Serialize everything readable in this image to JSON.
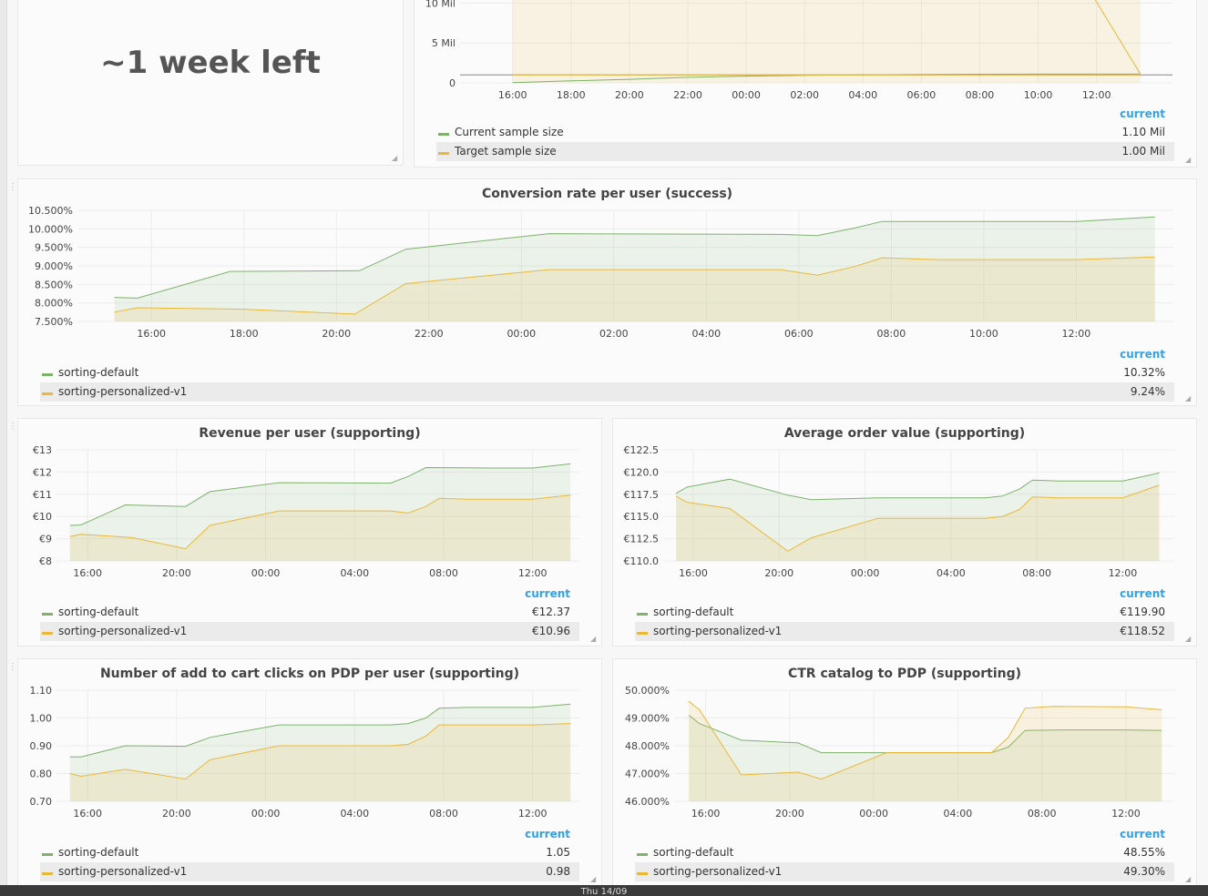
{
  "colors": {
    "green": "#7eb26d",
    "yellow": "#eab839",
    "accent": "#33a2e5"
  },
  "legend_header": "current",
  "singlestat": {
    "value": "~1 week left"
  },
  "bottom_bar": {
    "text": "Thu 14/09"
  },
  "panels": [
    {
      "id": "sample",
      "title": "",
      "series": [
        {
          "name": "Current sample size",
          "current": "1.10 Mil"
        },
        {
          "name": "Target sample size",
          "current": "1.00 Mil"
        }
      ]
    },
    {
      "id": "conversion",
      "title": "Conversion rate per user (success)",
      "series": [
        {
          "name": "sorting-default",
          "current": "10.32%"
        },
        {
          "name": "sorting-personalized-v1",
          "current": "9.24%"
        }
      ]
    },
    {
      "id": "revenue",
      "title": "Revenue per user (supporting)",
      "series": [
        {
          "name": "sorting-default",
          "current": "€12.37"
        },
        {
          "name": "sorting-personalized-v1",
          "current": "€10.96"
        }
      ]
    },
    {
      "id": "aov",
      "title": "Average order value (supporting)",
      "series": [
        {
          "name": "sorting-default",
          "current": "€119.90"
        },
        {
          "name": "sorting-personalized-v1",
          "current": "€118.52"
        }
      ]
    },
    {
      "id": "atc",
      "title": "Number of add to cart clicks on PDP per user (supporting)",
      "series": [
        {
          "name": "sorting-default",
          "current": "1.05"
        },
        {
          "name": "sorting-personalized-v1",
          "current": "0.98"
        }
      ]
    },
    {
      "id": "ctr",
      "title": "CTR catalog to PDP (supporting)",
      "series": [
        {
          "name": "sorting-default",
          "current": "48.55%"
        },
        {
          "name": "sorting-personalized-v1",
          "current": "49.30%"
        }
      ]
    }
  ],
  "chart_data": [
    {
      "id": "sample",
      "type": "area",
      "x_ticks": [
        "16:00",
        "18:00",
        "20:00",
        "22:00",
        "00:00",
        "02:00",
        "04:00",
        "06:00",
        "08:00",
        "10:00",
        "12:00"
      ],
      "y_ticks": [
        "0",
        "5 Mil",
        "10 Mil"
      ],
      "ylim": [
        0,
        10.5
      ],
      "series": [
        {
          "name": "Current sample size",
          "values": [
            [
              0,
              0.02
            ],
            [
              2,
              0.25
            ],
            [
              4,
              0.45
            ],
            [
              6,
              0.7
            ],
            [
              8,
              0.85
            ],
            [
              10,
              0.95
            ],
            [
              12,
              1.0
            ],
            [
              14,
              1.05
            ],
            [
              16,
              1.08
            ],
            [
              18,
              1.09
            ],
            [
              21.5,
              1.1
            ]
          ]
        },
        {
          "name": "Target sample size",
          "values": [
            [
              0,
              1.0
            ],
            [
              21.5,
              1.0
            ]
          ]
        }
      ]
    },
    {
      "id": "conversion",
      "type": "area",
      "x_ticks": [
        "16:00",
        "18:00",
        "20:00",
        "22:00",
        "00:00",
        "02:00",
        "04:00",
        "06:00",
        "08:00",
        "10:00",
        "12:00"
      ],
      "y_ticks": [
        "7.500%",
        "8.000%",
        "8.500%",
        "9.000%",
        "9.500%",
        "10.000%",
        "10.500%"
      ],
      "ylim": [
        7.5,
        10.5
      ],
      "series": [
        {
          "name": "sorting-default",
          "values": [
            [
              -0.8,
              8.15
            ],
            [
              -0.3,
              8.13
            ],
            [
              1.7,
              8.85
            ],
            [
              4.5,
              8.87
            ],
            [
              5.5,
              9.45
            ],
            [
              8.6,
              9.87
            ],
            [
              13.6,
              9.85
            ],
            [
              14.4,
              9.82
            ],
            [
              15.2,
              10.02
            ],
            [
              15.8,
              10.2
            ],
            [
              18,
              10.2
            ],
            [
              20,
              10.2
            ],
            [
              21.7,
              10.32
            ]
          ]
        },
        {
          "name": "sorting-personalized-v1",
          "values": [
            [
              -0.8,
              7.75
            ],
            [
              -0.3,
              7.87
            ],
            [
              2,
              7.83
            ],
            [
              4.4,
              7.7
            ],
            [
              5.5,
              8.52
            ],
            [
              8.6,
              8.9
            ],
            [
              13.6,
              8.9
            ],
            [
              14.4,
              8.75
            ],
            [
              15.2,
              8.98
            ],
            [
              15.8,
              9.22
            ],
            [
              17,
              9.17
            ],
            [
              20,
              9.17
            ],
            [
              21.7,
              9.24
            ]
          ]
        }
      ]
    },
    {
      "id": "revenue",
      "type": "area",
      "x_ticks": [
        "16:00",
        "20:00",
        "00:00",
        "04:00",
        "08:00",
        "12:00"
      ],
      "y_ticks": [
        "€8",
        "€9",
        "€10",
        "€11",
        "€12",
        "€13"
      ],
      "ylim": [
        8,
        13
      ],
      "series": [
        {
          "name": "sorting-default",
          "values": [
            [
              -0.8,
              9.6
            ],
            [
              -0.3,
              9.62
            ],
            [
              1.7,
              10.52
            ],
            [
              4.4,
              10.45
            ],
            [
              5.5,
              11.12
            ],
            [
              8.6,
              11.52
            ],
            [
              13.6,
              11.5
            ],
            [
              14.4,
              11.8
            ],
            [
              15.2,
              12.2
            ],
            [
              18,
              12.18
            ],
            [
              20,
              12.18
            ],
            [
              21.7,
              12.37
            ]
          ]
        },
        {
          "name": "sorting-personalized-v1",
          "values": [
            [
              -0.8,
              9.1
            ],
            [
              -0.3,
              9.2
            ],
            [
              2,
              9.05
            ],
            [
              4.4,
              8.55
            ],
            [
              5.5,
              9.6
            ],
            [
              8.6,
              10.25
            ],
            [
              13.6,
              10.25
            ],
            [
              14.4,
              10.15
            ],
            [
              15.2,
              10.45
            ],
            [
              15.8,
              10.82
            ],
            [
              17,
              10.78
            ],
            [
              20,
              10.78
            ],
            [
              21.7,
              10.96
            ]
          ]
        }
      ]
    },
    {
      "id": "aov",
      "type": "area",
      "x_ticks": [
        "16:00",
        "20:00",
        "00:00",
        "04:00",
        "08:00",
        "12:00"
      ],
      "y_ticks": [
        "€110.0",
        "€112.5",
        "€115.0",
        "€117.5",
        "€120.0",
        "€122.5"
      ],
      "ylim": [
        110,
        122.5
      ],
      "series": [
        {
          "name": "sorting-default",
          "values": [
            [
              -0.8,
              117.6
            ],
            [
              -0.3,
              118.3
            ],
            [
              1.7,
              119.2
            ],
            [
              4.4,
              117.4
            ],
            [
              5.5,
              116.9
            ],
            [
              8.6,
              117.1
            ],
            [
              13.6,
              117.1
            ],
            [
              14.4,
              117.3
            ],
            [
              15.2,
              118.1
            ],
            [
              15.8,
              119.1
            ],
            [
              17,
              119.0
            ],
            [
              20,
              119.0
            ],
            [
              21.7,
              119.9
            ]
          ]
        },
        {
          "name": "sorting-personalized-v1",
          "values": [
            [
              -0.8,
              117.3
            ],
            [
              -0.3,
              116.6
            ],
            [
              1.7,
              115.9
            ],
            [
              4.4,
              111.1
            ],
            [
              5.5,
              112.6
            ],
            [
              8.6,
              114.8
            ],
            [
              13.6,
              114.8
            ],
            [
              14.4,
              115.0
            ],
            [
              15.2,
              115.8
            ],
            [
              15.8,
              117.2
            ],
            [
              17,
              117.1
            ],
            [
              20,
              117.1
            ],
            [
              21.7,
              118.52
            ]
          ]
        }
      ]
    },
    {
      "id": "atc",
      "type": "area",
      "x_ticks": [
        "16:00",
        "20:00",
        "00:00",
        "04:00",
        "08:00",
        "12:00"
      ],
      "y_ticks": [
        "0.70",
        "0.80",
        "0.90",
        "1.00",
        "1.10"
      ],
      "ylim": [
        0.7,
        1.1
      ],
      "series": [
        {
          "name": "sorting-default",
          "values": [
            [
              -0.8,
              0.86
            ],
            [
              -0.3,
              0.86
            ],
            [
              1.7,
              0.9
            ],
            [
              4.4,
              0.898
            ],
            [
              5.5,
              0.93
            ],
            [
              8.6,
              0.975
            ],
            [
              13.6,
              0.975
            ],
            [
              14.4,
              0.98
            ],
            [
              15.2,
              1.0
            ],
            [
              15.8,
              1.035
            ],
            [
              17,
              1.038
            ],
            [
              20,
              1.038
            ],
            [
              21.7,
              1.05
            ]
          ]
        },
        {
          "name": "sorting-personalized-v1",
          "values": [
            [
              -0.8,
              0.8
            ],
            [
              -0.3,
              0.79
            ],
            [
              1.7,
              0.815
            ],
            [
              4.4,
              0.78
            ],
            [
              5.5,
              0.85
            ],
            [
              8.6,
              0.9
            ],
            [
              13.6,
              0.9
            ],
            [
              14.4,
              0.905
            ],
            [
              15.2,
              0.935
            ],
            [
              15.8,
              0.975
            ],
            [
              17,
              0.975
            ],
            [
              20,
              0.975
            ],
            [
              21.7,
              0.98
            ]
          ]
        }
      ]
    },
    {
      "id": "ctr",
      "type": "area",
      "x_ticks": [
        "16:00",
        "20:00",
        "00:00",
        "04:00",
        "08:00",
        "12:00"
      ],
      "y_ticks": [
        "46.000%",
        "47.000%",
        "48.000%",
        "49.000%",
        "50.000%"
      ],
      "ylim": [
        46,
        50
      ],
      "series": [
        {
          "name": "sorting-default",
          "values": [
            [
              -0.8,
              49.1
            ],
            [
              -0.3,
              48.8
            ],
            [
              1.7,
              48.2
            ],
            [
              4.4,
              48.1
            ],
            [
              5.5,
              47.75
            ],
            [
              8.6,
              47.75
            ],
            [
              13.6,
              47.75
            ],
            [
              14.4,
              47.95
            ],
            [
              15.2,
              48.55
            ],
            [
              17,
              48.57
            ],
            [
              20,
              48.57
            ],
            [
              21.7,
              48.55
            ]
          ]
        },
        {
          "name": "sorting-personalized-v1",
          "values": [
            [
              -0.8,
              49.6
            ],
            [
              -0.3,
              49.3
            ],
            [
              1.7,
              46.95
            ],
            [
              4.4,
              47.05
            ],
            [
              5.5,
              46.8
            ],
            [
              8.6,
              47.75
            ],
            [
              13.6,
              47.75
            ],
            [
              14.4,
              48.3
            ],
            [
              15.2,
              49.35
            ],
            [
              16.5,
              49.42
            ],
            [
              20,
              49.4
            ],
            [
              21.7,
              49.3
            ]
          ]
        }
      ]
    }
  ]
}
